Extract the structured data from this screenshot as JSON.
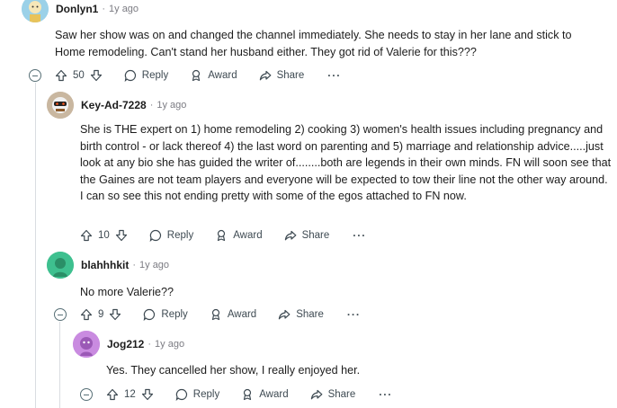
{
  "comments": [
    {
      "author": "Donlyn1",
      "time": "1y ago",
      "body": "Saw her show was on and changed the channel immediately. She needs to stay in her lane and stick to Home remodeling. Can't stand her husband either. They got rid of Valerie for this???",
      "votes": "50"
    },
    {
      "author": "Key-Ad-7228",
      "time": "1y ago",
      "body": "She is THE expert on 1) home remodeling 2) cooking 3) women's health issues including pregnancy and birth control - or lack thereof 4) the last word on parenting and 5) marriage and relationship advice.....just look at any bio she has guided the writer of........both are legends in their own minds. FN will soon see that the Gaines are not team players and everyone will be expected to tow their line not the other way around. I can so see this not ending pretty with some of the egos attached to FN now.",
      "votes": "10"
    },
    {
      "author": "blahhhkit",
      "time": "1y ago",
      "body": "No more Valerie??",
      "votes": "9"
    },
    {
      "author": "Jog212",
      "time": "1y ago",
      "body": "Yes. They cancelled her show, I really enjoyed her.",
      "votes": "12"
    }
  ],
  "labels": {
    "separator": "·",
    "reply": "Reply",
    "award": "Award",
    "share": "Share",
    "more": "···"
  },
  "colors": {
    "text": "#1c1c1c",
    "meta": "#7c7c83",
    "action": "#3e4a52",
    "thread_line": "#d9dde1",
    "avatar_donlyn1": "#9bd1e8",
    "avatar_keyad": "#c9b7a0",
    "avatar_blahhhkit": "#3ec08f",
    "avatar_jog212": "#c98be0"
  }
}
